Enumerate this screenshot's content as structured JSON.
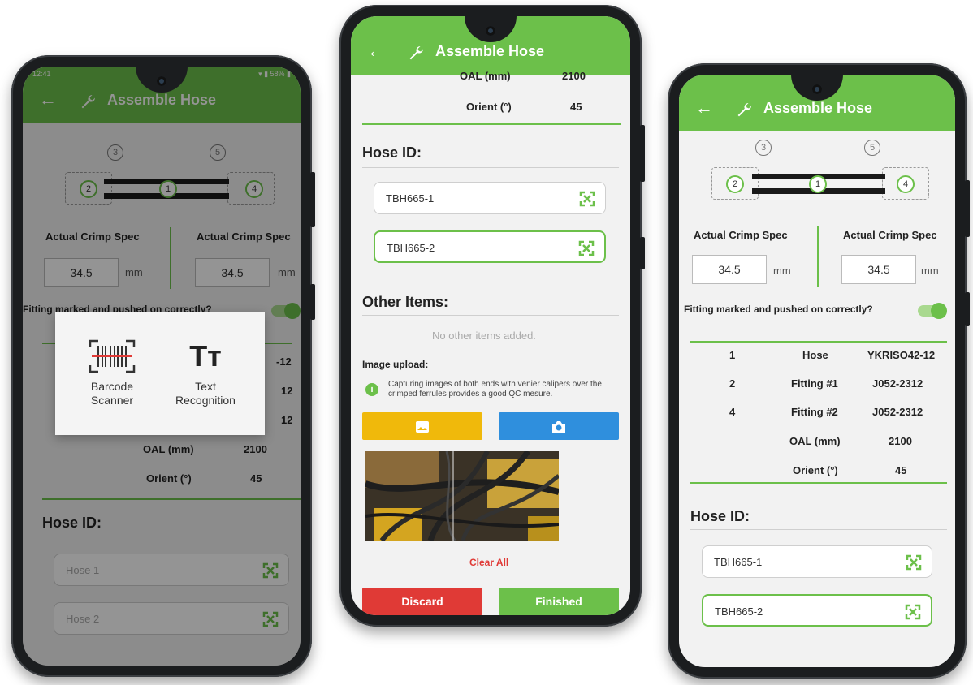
{
  "app": {
    "title": "Assemble Hose",
    "back_glyph": "←",
    "accent": "#6cc04a"
  },
  "status_bar": {
    "time": "12:41",
    "icons": "▾ ▮ 58% ▮"
  },
  "diagram": {
    "top_labels": [
      "3",
      "5"
    ],
    "fitting_labels": [
      "2",
      "1",
      "4"
    ]
  },
  "crimp": {
    "left_label": "Actual Crimp Spec",
    "right_label": "Actual Crimp Spec",
    "left_value": "34.5",
    "right_value": "34.5",
    "unit": "mm"
  },
  "fitting_check": {
    "label": "Fitting marked and pushed on correctly?",
    "enabled": true
  },
  "components": [
    {
      "num": "1",
      "name": "Hose",
      "code": "YKRISO42-12"
    },
    {
      "num": "2",
      "name": "Fitting #1",
      "code": "J052-2312"
    },
    {
      "num": "4",
      "name": "Fitting #2",
      "code": "J052-2312"
    }
  ],
  "measurements": [
    {
      "name": "OAL (mm)",
      "value": "2100"
    },
    {
      "name": "Orient (°)",
      "value": "45"
    }
  ],
  "phone1": {
    "clipped_codes": [
      "-12",
      "12",
      "12"
    ],
    "hose_id_heading": "Hose ID:",
    "placeholders": [
      "Hose 1",
      "Hose 2"
    ],
    "scanner_dialog": {
      "barcode_label": "Barcode\nScanner",
      "text_label": "Text\nRecognition",
      "text_glyph": "Tт"
    }
  },
  "phone2": {
    "hose_id_heading": "Hose ID:",
    "hose_ids": [
      "TBH665-1",
      "TBH665-2"
    ],
    "other_items_heading": "Other Items:",
    "other_items_empty": "No other items added.",
    "image_upload_label": "Image upload:",
    "image_upload_note": "Capturing images of both ends with venier calipers over the crimped ferrules provides a good QC mesure.",
    "clear_all": "Clear All",
    "discard": "Discard",
    "finished": "Finished",
    "colors": {
      "gallery": "#f0b90b",
      "camera": "#2f8fdd",
      "discard": "#e03a36",
      "finished": "#6cc04a"
    }
  },
  "phone3": {
    "hose_id_heading": "Hose ID:",
    "hose_ids": [
      "TBH665-1",
      "TBH665-2"
    ]
  }
}
